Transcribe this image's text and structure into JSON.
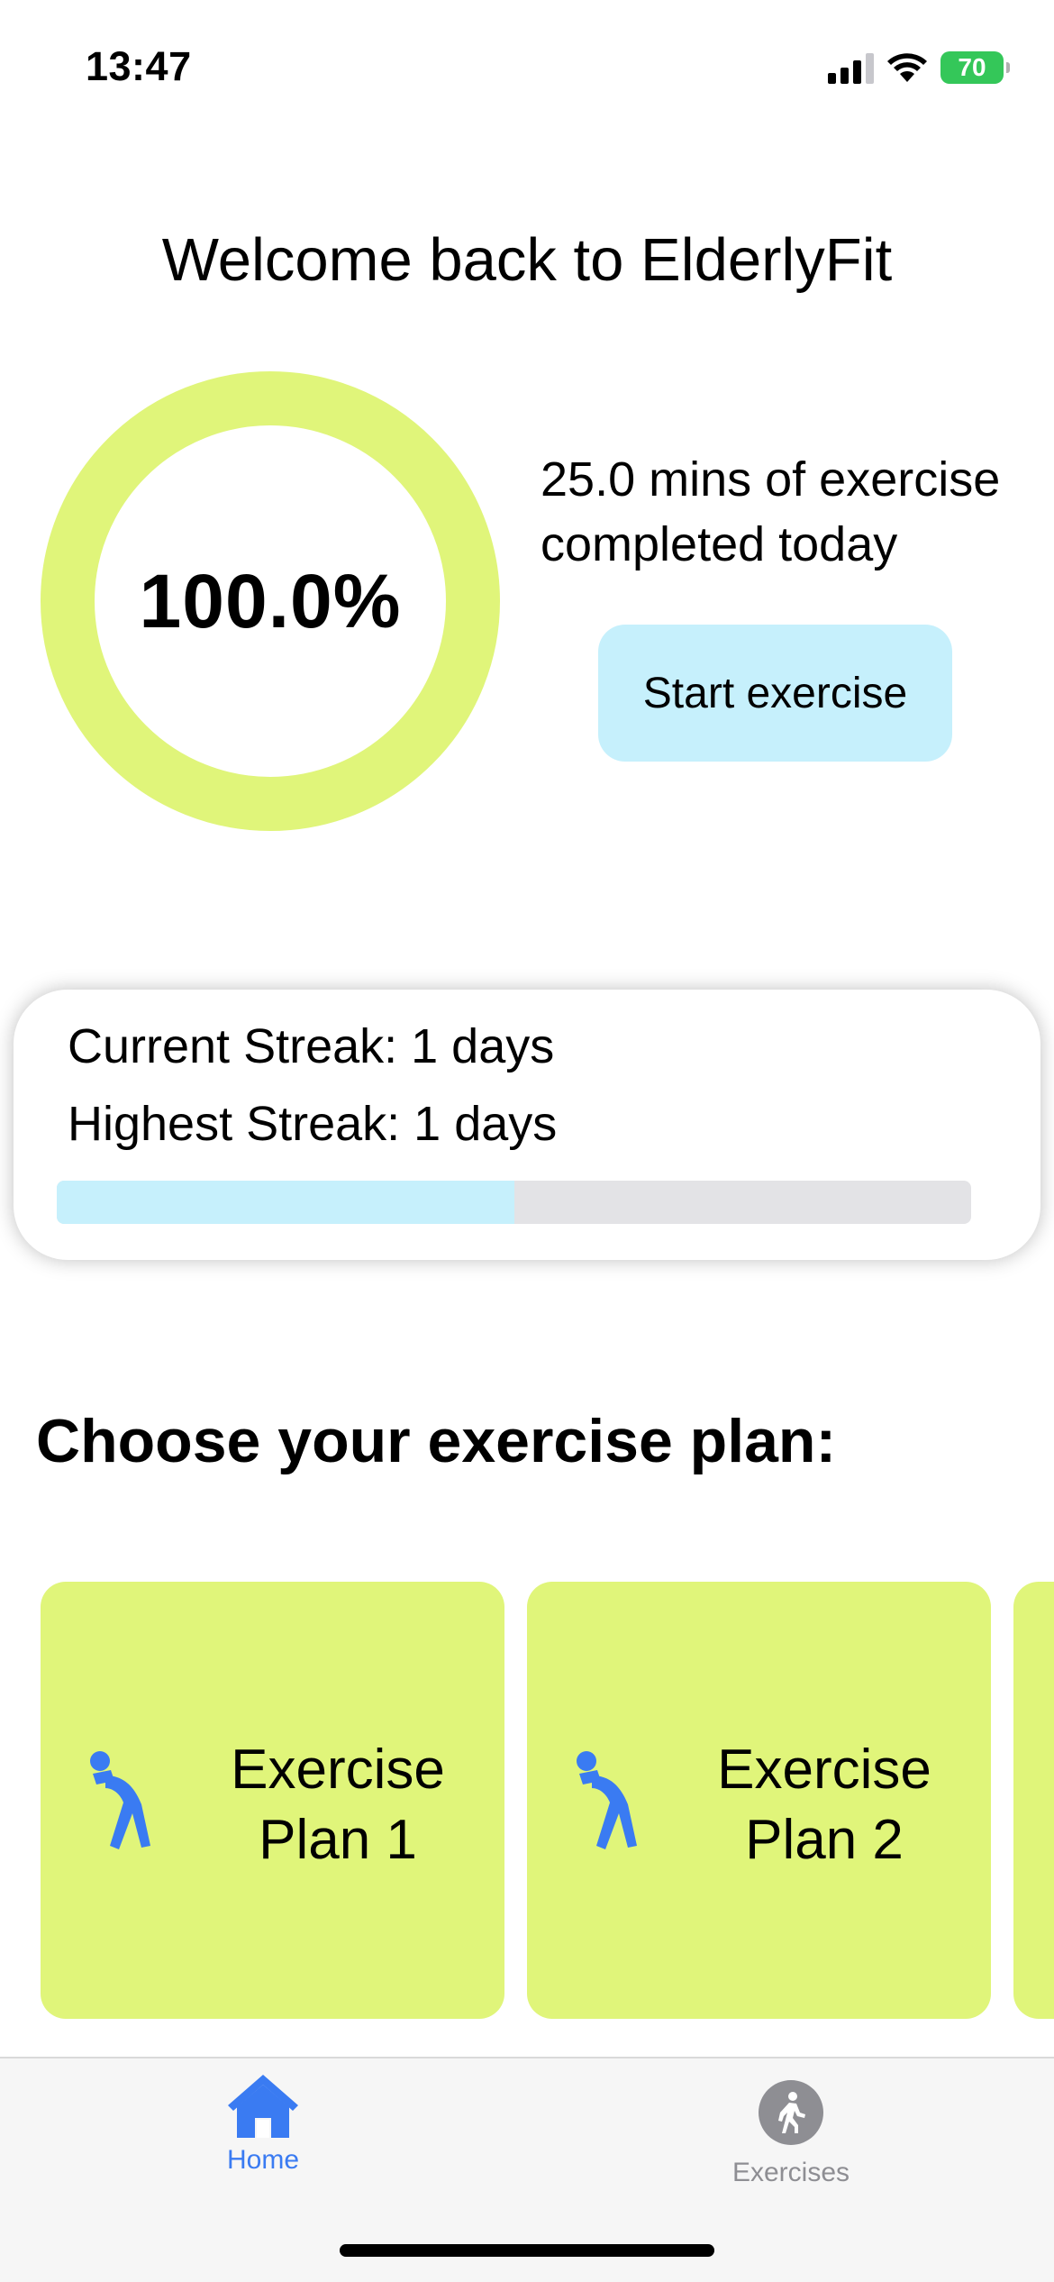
{
  "status_bar": {
    "time": "13:47",
    "battery_level": "70",
    "icons": [
      "signal-icon",
      "wifi-icon",
      "battery-icon"
    ],
    "battery_color": "#34c759"
  },
  "header": {
    "title": "Welcome back to ElderlyFit"
  },
  "progress": {
    "percent_label": "100.0%",
    "percent_value": 100.0,
    "summary_line1": "25.0 mins of exercise",
    "summary_line2": "completed today",
    "ring_color": "#e0f57a"
  },
  "start_button": {
    "label": "Start exercise",
    "color": "#c6f0fc"
  },
  "streak": {
    "current": "Current Streak: 1 days",
    "highest": "Highest Streak: 1 days",
    "progress_fraction": 0.5,
    "fill_color": "#c6f0fc"
  },
  "plans": {
    "heading": "Choose your exercise plan:",
    "items": [
      {
        "line1": "Exercise",
        "line2": "Plan 1",
        "icon": "stretching-person-icon"
      },
      {
        "line1": "Exercise",
        "line2": "Plan 2",
        "icon": "stretching-person-icon"
      }
    ],
    "card_color": "#e0f57a",
    "icon_color": "#3a7bf2"
  },
  "tab_bar": {
    "tabs": [
      {
        "label": "Home",
        "icon": "home-icon",
        "active": true
      },
      {
        "label": "Exercises",
        "icon": "walking-person-icon",
        "active": false
      }
    ],
    "active_color": "#3a7bf2",
    "inactive_color": "#8e8e93"
  }
}
